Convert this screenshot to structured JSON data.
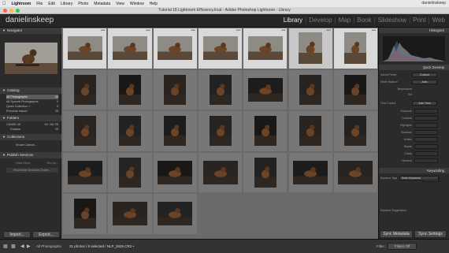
{
  "menubar": {
    "app": "Lightroom",
    "items": [
      "File",
      "Edit",
      "Library",
      "Photo",
      "Metadata",
      "View",
      "Window",
      "Help"
    ],
    "right": "danielinskeep"
  },
  "window": {
    "title": "Tutorial 18 Lightroom Efficiency.lrcat - Adobe Photoshop Lightroom - Library"
  },
  "identity": {
    "name": "danielinskeep"
  },
  "modules": [
    "Library",
    "Develop",
    "Map",
    "Book",
    "Slideshow",
    "Print",
    "Web"
  ],
  "left": {
    "navigator": "Navigator",
    "catalog": "Catalog",
    "catalog_items": [
      {
        "label": "All Photographs",
        "count": "25"
      },
      {
        "label": "All Synced Photographs",
        "count": "0"
      },
      {
        "label": "Quick Collection +",
        "count": "0"
      },
      {
        "label": "Previous Import",
        "count": "25"
      }
    ],
    "folders": "Folders",
    "folder_items": [
      {
        "label": "CAN5D 4K",
        "count": "54 / 54 TB"
      },
      {
        "label": "Dodson",
        "count": "25"
      }
    ],
    "collections": "Collections",
    "collection_items": [
      {
        "label": "Smart Collecti...",
        "count": ""
      }
    ],
    "publish": "Publish Services",
    "publish_items": [
      {
        "label": "Hard Drive",
        "count": "Set Up..."
      }
    ],
    "find_more": "Find More Services Online...",
    "import_btn": "Import...",
    "export_btn": "Export..."
  },
  "right": {
    "histogram": "Histogram",
    "quick_develop": "Quick Develop",
    "saved_preset": {
      "label": "Saved Preset",
      "value": "Custom"
    },
    "white_balance": {
      "label": "White Balance",
      "value": "Auto"
    },
    "temperature": "Temperature",
    "tint": "Tint",
    "tone_control": {
      "label": "Tone Control",
      "value": "Auto Tone"
    },
    "tone_rows": [
      "Exposure",
      "Contrast",
      "Highlights",
      "Shadows",
      "Whites",
      "Blacks",
      "Clarity",
      "Vibrance"
    ],
    "reset": "Reset All",
    "keywording": "Keywording",
    "keyword_tags": {
      "label": "Keyword Tags",
      "value": "Enter Keywords"
    },
    "keyword_suggestions": "Keyword Suggestions",
    "sync_metadata": "Sync Metadata",
    "sync_settings": "Sync Settings"
  },
  "toolbar": {
    "sources": "All Photographs",
    "status": "31 photos / 8 selected / NLP_2626.CR2 •",
    "filter_label": "Filter :",
    "filter_value": "Filters Off"
  }
}
